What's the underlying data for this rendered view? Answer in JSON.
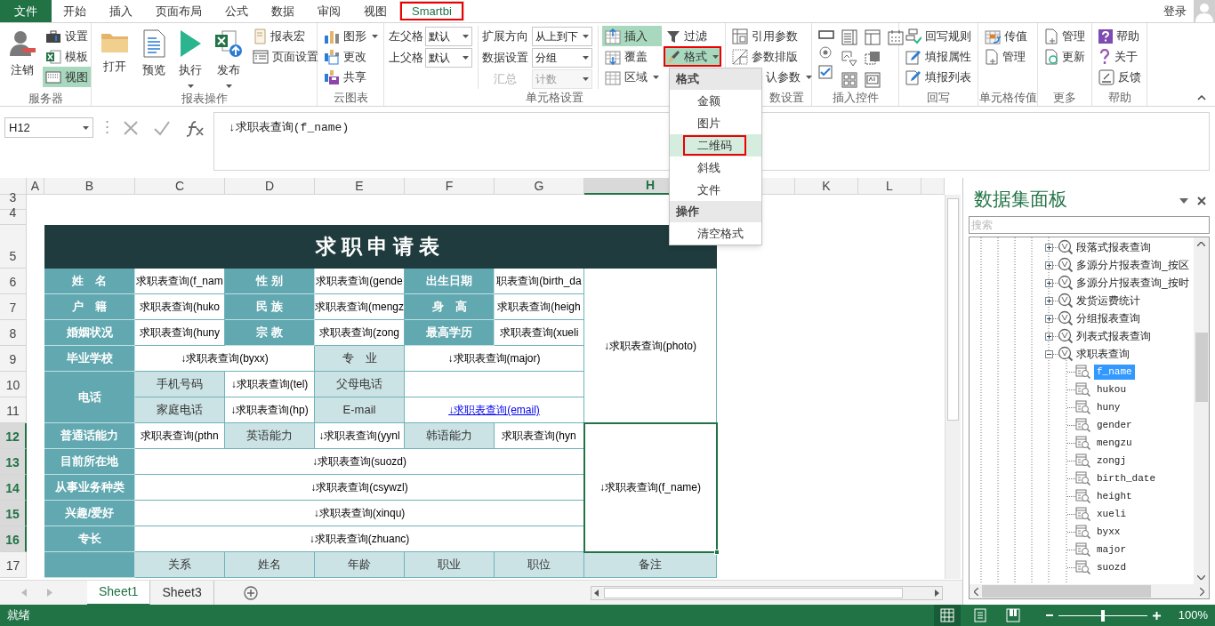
{
  "tabs": [
    {
      "label": "文件",
      "kind": "file",
      "selected": false,
      "highlighted": false
    },
    {
      "label": "开始",
      "kind": "tab",
      "selected": false,
      "highlighted": false
    },
    {
      "label": "插入",
      "kind": "tab",
      "selected": false,
      "highlighted": false
    },
    {
      "label": "页面布局",
      "kind": "tab",
      "selected": false,
      "highlighted": false
    },
    {
      "label": "公式",
      "kind": "tab",
      "selected": false,
      "highlighted": false
    },
    {
      "label": "数据",
      "kind": "tab",
      "selected": false,
      "highlighted": false
    },
    {
      "label": "审阅",
      "kind": "tab",
      "selected": false,
      "highlighted": false
    },
    {
      "label": "视图",
      "kind": "tab",
      "selected": false,
      "highlighted": false
    },
    {
      "label": "Smartbi",
      "kind": "tab",
      "selected": true,
      "highlighted": true
    }
  ],
  "account": {
    "label": "登录"
  },
  "ribbon_groups": [
    {
      "label": "服务器",
      "columns": [
        [
          {
            "kind": "large",
            "label": "注销",
            "selected": false
          }
        ],
        [
          {
            "kind": "small",
            "label": "设置",
            "selected": false
          },
          {
            "kind": "small",
            "label": "模板",
            "selected": false
          },
          {
            "kind": "small",
            "label": "视图",
            "selected": true
          }
        ]
      ]
    },
    {
      "label": "报表操作",
      "columns": [
        [
          {
            "kind": "large",
            "label": "打开",
            "selected": false
          }
        ],
        [
          {
            "kind": "large",
            "label": "预览",
            "selected": false
          }
        ],
        [
          {
            "kind": "large",
            "label": "执行",
            "selected": false,
            "dropdown": true
          }
        ],
        [
          {
            "kind": "large",
            "label": "发布",
            "selected": false,
            "dropdown": true
          }
        ],
        [
          {
            "kind": "small",
            "label": "报表宏",
            "selected": false
          },
          {
            "kind": "small",
            "label": "页面设置",
            "selected": false
          }
        ]
      ]
    },
    {
      "label": "云图表",
      "columns": [
        [
          {
            "kind": "small",
            "label": "图形",
            "selected": false,
            "dropdown": true
          },
          {
            "kind": "small",
            "label": "更改",
            "selected": false
          },
          {
            "kind": "small",
            "label": "共享",
            "selected": false
          }
        ]
      ]
    },
    {
      "label": "单元格设置",
      "columns": [
        [
          {
            "kind": "combo",
            "label": "左父格",
            "value": "默认",
            "disabled": false
          },
          {
            "kind": "combo",
            "label": "上父格",
            "value": "默认",
            "disabled": false
          }
        ],
        [
          {
            "kind": "combo",
            "label": "扩展方向",
            "value": "从上到下",
            "disabled": false
          },
          {
            "kind": "combo",
            "label": "数据设置",
            "value": "分组",
            "disabled": false
          },
          {
            "kind": "combo",
            "label": "汇总",
            "value": "计数",
            "disabled": true
          }
        ],
        [
          {
            "kind": "small",
            "label": "插入",
            "selected": true
          },
          {
            "kind": "small",
            "label": "覆盖",
            "selected": false
          },
          {
            "kind": "small",
            "label": "区域",
            "selected": false,
            "dropdown": true
          }
        ],
        [
          {
            "kind": "small",
            "label": "过滤",
            "selected": false
          },
          {
            "kind": "small",
            "label": "格式",
            "selected": true,
            "dropdown": true,
            "highlighted": true
          }
        ]
      ]
    },
    {
      "label": "数设置",
      "columns": [
        [
          {
            "kind": "small",
            "label": "引用参数",
            "selected": false
          },
          {
            "kind": "small",
            "label": "参数排版",
            "selected": false
          },
          {
            "kind": "small",
            "label": "认参数",
            "selected": false,
            "dropdown": true
          }
        ]
      ]
    },
    {
      "label": "插入控件",
      "columns": [
        [
          {
            "kind": "control"
          },
          {
            "kind": "control"
          },
          {
            "kind": "control"
          }
        ],
        [
          {
            "kind": "control"
          },
          {
            "kind": "control"
          },
          {
            "kind": "control"
          }
        ],
        [
          {
            "kind": "control"
          },
          {
            "kind": "control"
          },
          {
            "kind": "control"
          }
        ],
        [
          {
            "kind": "control"
          }
        ]
      ]
    },
    {
      "label": "回写",
      "columns": [
        [
          {
            "kind": "small",
            "label": "回写规则",
            "selected": false
          },
          {
            "kind": "small",
            "label": "填报属性",
            "selected": false
          },
          {
            "kind": "small",
            "label": "填报列表",
            "selected": false
          }
        ]
      ]
    },
    {
      "label": "单元格传值",
      "columns": [
        [
          {
            "kind": "small",
            "label": "传值",
            "selected": false
          },
          {
            "kind": "small",
            "label": "管理",
            "selected": false
          }
        ]
      ]
    },
    {
      "label": "更多",
      "columns": [
        [
          {
            "kind": "small",
            "label": "管理",
            "selected": false
          },
          {
            "kind": "small",
            "label": "更新",
            "selected": false
          }
        ]
      ]
    },
    {
      "label": "帮助",
      "columns": [
        [
          {
            "kind": "small",
            "label": "帮助",
            "selected": false
          },
          {
            "kind": "small",
            "label": "关于",
            "selected": false
          },
          {
            "kind": "small",
            "label": "反馈",
            "selected": false
          }
        ]
      ]
    }
  ],
  "format_menu": {
    "sections": [
      {
        "header": "格式",
        "items": [
          {
            "label": "金额",
            "selected": false,
            "highlighted": false
          },
          {
            "label": "图片",
            "selected": false,
            "highlighted": false
          },
          {
            "label": "二维码",
            "selected": true,
            "highlighted": true
          },
          {
            "label": "斜线",
            "selected": false,
            "highlighted": false
          },
          {
            "label": "文件",
            "selected": false,
            "highlighted": false
          }
        ]
      },
      {
        "header": "操作",
        "items": [
          {
            "label": "清空格式",
            "selected": false,
            "highlighted": false
          }
        ]
      }
    ]
  },
  "formula_bar": {
    "cell_name": "H12",
    "formula": "↓求职表查询(f_name)"
  },
  "columns": [
    {
      "label": "A",
      "selected": false
    },
    {
      "label": "B",
      "selected": false
    },
    {
      "label": "C",
      "selected": false
    },
    {
      "label": "D",
      "selected": false
    },
    {
      "label": "E",
      "selected": false
    },
    {
      "label": "F",
      "selected": false
    },
    {
      "label": "G",
      "selected": false
    },
    {
      "label": "H",
      "selected": true
    },
    {
      "label": "K",
      "selected": false
    },
    {
      "label": "L",
      "selected": false
    }
  ],
  "rows": [
    {
      "label": "3",
      "selected": false
    },
    {
      "label": "4",
      "selected": false
    },
    {
      "label": "5",
      "selected": false
    },
    {
      "label": "6",
      "selected": false
    },
    {
      "label": "7",
      "selected": false
    },
    {
      "label": "8",
      "selected": false
    },
    {
      "label": "9",
      "selected": false
    },
    {
      "label": "10",
      "selected": false
    },
    {
      "label": "11",
      "selected": false
    },
    {
      "label": "12",
      "selected": true
    },
    {
      "label": "13",
      "selected": true
    },
    {
      "label": "14",
      "selected": true
    },
    {
      "label": "15",
      "selected": true
    },
    {
      "label": "16",
      "selected": true
    },
    {
      "label": "17",
      "selected": false
    }
  ],
  "cells": [
    {
      "kind": "title",
      "text": "求职申请表",
      "selected": false
    },
    {
      "kind": "label",
      "text": "姓　名",
      "selected": false
    },
    {
      "kind": "value",
      "text": "求职表查询(f_nam",
      "selected": false
    },
    {
      "kind": "label",
      "text": "性 别",
      "selected": false
    },
    {
      "kind": "value",
      "text": "求职表查询(gende",
      "selected": false
    },
    {
      "kind": "label",
      "text": "出生日期",
      "selected": false
    },
    {
      "kind": "value",
      "text": "职表查询(birth_da",
      "selected": false
    },
    {
      "kind": "value",
      "text": "↓求职表查询(photo)",
      "selected": false
    },
    {
      "kind": "label",
      "text": "户　籍",
      "selected": false
    },
    {
      "kind": "value",
      "text": "求职表查询(huko",
      "selected": false
    },
    {
      "kind": "label",
      "text": "民 族",
      "selected": false
    },
    {
      "kind": "value",
      "text": "求职表查询(mengz",
      "selected": false
    },
    {
      "kind": "label",
      "text": "身　高",
      "selected": false
    },
    {
      "kind": "value",
      "text": "求职表查询(heigh",
      "selected": false
    },
    {
      "kind": "label",
      "text": "婚姻状况",
      "selected": false
    },
    {
      "kind": "value",
      "text": "求职表查询(huny",
      "selected": false
    },
    {
      "kind": "label",
      "text": "宗 教",
      "selected": false
    },
    {
      "kind": "value",
      "text": "求职表查询(zong",
      "selected": false
    },
    {
      "kind": "label",
      "text": "最高学历",
      "selected": false
    },
    {
      "kind": "value",
      "text": "求职表查询(xueli",
      "selected": false
    },
    {
      "kind": "label",
      "text": "毕业学校",
      "selected": false
    },
    {
      "kind": "value",
      "text": "↓求职表查询(byxx)",
      "selected": false
    },
    {
      "kind": "sublabel",
      "text": "专　业",
      "selected": false
    },
    {
      "kind": "value",
      "text": "↓求职表查询(major)",
      "selected": false
    },
    {
      "kind": "label",
      "text": "电话",
      "selected": false
    },
    {
      "kind": "sublabel",
      "text": "手机号码",
      "selected": false
    },
    {
      "kind": "value",
      "text": "↓求职表查询(tel)",
      "selected": false
    },
    {
      "kind": "sublabel",
      "text": "父母电话",
      "selected": false
    },
    {
      "kind": "value",
      "selected": false
    },
    {
      "kind": "sublabel",
      "text": "家庭电话",
      "selected": false
    },
    {
      "kind": "value",
      "text": "↓求职表查询(hp)",
      "selected": false
    },
    {
      "kind": "sublabel",
      "text": "E-mail",
      "selected": false
    },
    {
      "kind": "link",
      "text": "↓求职表查询(email)",
      "selected": false
    },
    {
      "kind": "label",
      "text": "普通话能力",
      "selected": false
    },
    {
      "kind": "value",
      "text": "求职表查询(pthn",
      "selected": false
    },
    {
      "kind": "sublabel",
      "text": "英语能力",
      "selected": false
    },
    {
      "kind": "value",
      "text": "↓求职表查询(yynl",
      "selected": false
    },
    {
      "kind": "sublabel",
      "text": "韩语能力",
      "selected": false
    },
    {
      "kind": "value",
      "text": "求职表查询(hyn",
      "selected": false
    },
    {
      "kind": "value",
      "text": "↓求职表查询(f_name)",
      "selected": true
    },
    {
      "kind": "label",
      "text": "目前所在地",
      "selected": false
    },
    {
      "kind": "value",
      "text": "↓求职表查询(suozd)",
      "selected": false
    },
    {
      "kind": "label",
      "text": "从事业务种类",
      "selected": false
    },
    {
      "kind": "value",
      "text": "↓求职表查询(csywzl)",
      "selected": false
    },
    {
      "kind": "label",
      "text": "兴趣/爱好",
      "selected": false
    },
    {
      "kind": "value",
      "text": "↓求职表查询(xinqu)",
      "selected": false
    },
    {
      "kind": "label",
      "text": "专长",
      "selected": false
    },
    {
      "kind": "value",
      "text": "↓求职表查询(zhuanc)",
      "selected": false
    },
    {
      "kind": "label",
      "selected": false
    },
    {
      "kind": "sublabel",
      "text": "关系",
      "selected": false
    },
    {
      "kind": "sublabel",
      "text": "姓名",
      "selected": false
    },
    {
      "kind": "sublabel",
      "text": "年龄",
      "selected": false
    },
    {
      "kind": "sublabel",
      "text": "职业",
      "selected": false
    },
    {
      "kind": "sublabel",
      "text": "职位",
      "selected": false
    },
    {
      "kind": "sublabel",
      "text": "备注",
      "selected": false
    }
  ],
  "sheets": [
    {
      "label": "Sheet1",
      "selected": true
    },
    {
      "label": "Sheet3",
      "selected": false
    }
  ],
  "dataset_panel": {
    "title": "数据集面板",
    "search": {
      "placeholder": "搜索"
    },
    "tree": [
      {
        "label": "段落式报表查询",
        "expanded": false
      },
      {
        "label": "多源分片报表查询_按区",
        "expanded": false
      },
      {
        "label": "多源分片报表查询_按时",
        "expanded": false
      },
      {
        "label": "发货运费统计",
        "expanded": false
      },
      {
        "label": "分组报表查询",
        "expanded": false
      },
      {
        "label": "列表式报表查询",
        "expanded": false
      },
      {
        "label": "求职表查询",
        "expanded": true,
        "children": [
          {
            "label": "f_name",
            "selected": true
          },
          {
            "label": "hukou",
            "selected": false
          },
          {
            "label": "huny",
            "selected": false
          },
          {
            "label": "gender",
            "selected": false
          },
          {
            "label": "mengzu",
            "selected": false
          },
          {
            "label": "zongj",
            "selected": false
          },
          {
            "label": "birth_date",
            "selected": false
          },
          {
            "label": "height",
            "selected": false
          },
          {
            "label": "xueli",
            "selected": false
          },
          {
            "label": "byxx",
            "selected": false
          },
          {
            "label": "major",
            "selected": false
          },
          {
            "label": "suozd",
            "selected": false
          }
        ]
      }
    ]
  },
  "status_bar": {
    "text": "就绪",
    "views": [
      {
        "selected": true
      },
      {
        "selected": false
      },
      {
        "selected": false
      }
    ],
    "zoom": {
      "level": 0.5,
      "reading": "100%"
    }
  }
}
